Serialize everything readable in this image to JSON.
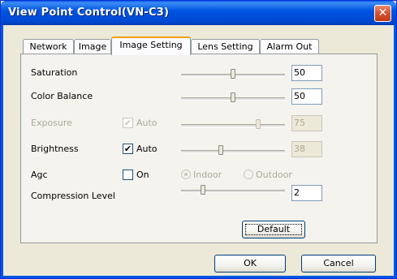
{
  "window": {
    "title": "View Point Control(VN-C3)",
    "close_glyph": "✕"
  },
  "tabs": [
    {
      "label": "Network",
      "active": false
    },
    {
      "label": "Image",
      "active": false
    },
    {
      "label": "Image Setting",
      "active": true
    },
    {
      "label": "Lens Setting",
      "active": false
    },
    {
      "label": "Alarm Out",
      "active": false
    }
  ],
  "settings": {
    "saturation": {
      "label": "Saturation",
      "value": "50",
      "slider_level": 0.5
    },
    "color_balance": {
      "label": "Color Balance",
      "value": "50",
      "slider_level": 0.5
    },
    "exposure": {
      "label": "Exposure",
      "auto_label": "Auto",
      "auto_checked": true,
      "enabled": false,
      "value": "75",
      "slider_level": 0.75
    },
    "brightness": {
      "label": "Brightness",
      "auto_label": "Auto",
      "auto_checked": true,
      "value": "38",
      "value_enabled": false,
      "slider_level": 0.38
    },
    "agc": {
      "label": "Agc",
      "on_label": "On",
      "on_checked": false,
      "indoor_label": "Indoor",
      "outdoor_label": "Outdoor",
      "selected": "indoor",
      "radios_enabled": false
    },
    "compression": {
      "label": "Compression Level",
      "value": "2",
      "slider_level": 0.2
    }
  },
  "buttons": {
    "default_label": "Default",
    "ok_label": "OK",
    "cancel_label": "Cancel"
  },
  "colors": {
    "title_bar": "#0054e3",
    "close_button": "#d4512f",
    "active_tab_accent": "#f0a000",
    "disabled_text": "#aca899"
  },
  "icons": {
    "close": "close-icon",
    "check": "check-icon"
  }
}
